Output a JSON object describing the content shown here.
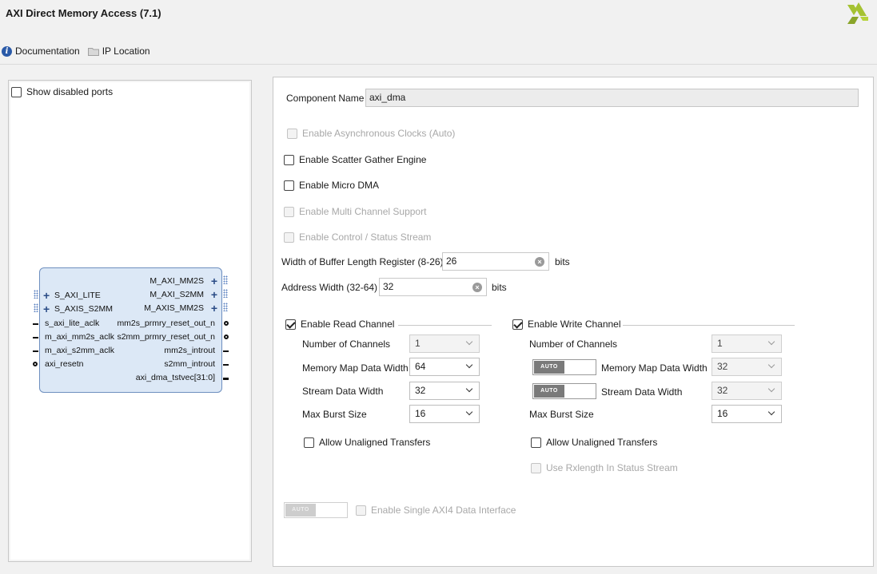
{
  "header": {
    "title": "AXI Direct Memory Access (7.1)",
    "links": [
      {
        "label": "Documentation",
        "icon": "info-icon"
      },
      {
        "label": "IP Location",
        "icon": "folder-icon"
      }
    ],
    "brand_color": "#a5c232"
  },
  "left_panel": {
    "show_disabled_ports_label": "Show disabled ports",
    "show_disabled_ports_checked": false,
    "block": {
      "left_ports": [
        "S_AXI_LITE",
        "S_AXIS_S2MM",
        "s_axi_lite_aclk",
        "m_axi_mm2s_aclk",
        "m_axi_s2mm_aclk",
        "axi_resetn"
      ],
      "right_ports": [
        "M_AXI_MM2S",
        "M_AXI_S2MM",
        "M_AXIS_MM2S",
        "mm2s_prmry_reset_out_n",
        "s2mm_prmry_reset_out_n",
        "mm2s_introut",
        "s2mm_introut",
        "axi_dma_tstvec[31:0]"
      ]
    }
  },
  "config": {
    "component_name_label": "Component Name",
    "component_name_value": "axi_dma",
    "options": [
      {
        "label": "Enable Asynchronous Clocks (Auto)",
        "checked": false,
        "enabled": false
      },
      {
        "label": "Enable Scatter Gather Engine",
        "checked": false,
        "enabled": true
      },
      {
        "label": "Enable Micro DMA",
        "checked": false,
        "enabled": true
      },
      {
        "label": "Enable Multi Channel Support",
        "checked": false,
        "enabled": false
      },
      {
        "label": "Enable Control / Status Stream",
        "checked": false,
        "enabled": false
      }
    ],
    "buffer_length": {
      "label": "Width of Buffer Length Register (8-26)",
      "value": "26",
      "unit": "bits"
    },
    "address_width": {
      "label": "Address Width (32-64)",
      "value": "32",
      "unit": "bits"
    },
    "read_channel": {
      "label": "Enable Read Channel",
      "checked": true,
      "num_channels_label": "Number of Channels",
      "num_channels": "1",
      "mm_width_label": "Memory Map Data Width",
      "mm_width": "64",
      "stream_width_label": "Stream Data Width",
      "stream_width": "32",
      "burst_label": "Max Burst Size",
      "burst": "16",
      "unaligned_label": "Allow Unaligned Transfers"
    },
    "write_channel": {
      "label": "Enable Write Channel",
      "checked": true,
      "num_channels_label": "Number of Channels",
      "num_channels": "1",
      "mm_width_label": "Memory Map Data Width",
      "mm_width": "32",
      "stream_width_label": "Stream Data Width",
      "stream_width": "32",
      "burst_label": "Max Burst Size",
      "burst": "16",
      "unaligned_label": "Allow Unaligned Transfers",
      "rxlength_label": "Use Rxlength In Status Stream"
    },
    "toggle_label": "AUTO",
    "single_axi4_label": "Enable Single AXI4 Data Interface"
  }
}
